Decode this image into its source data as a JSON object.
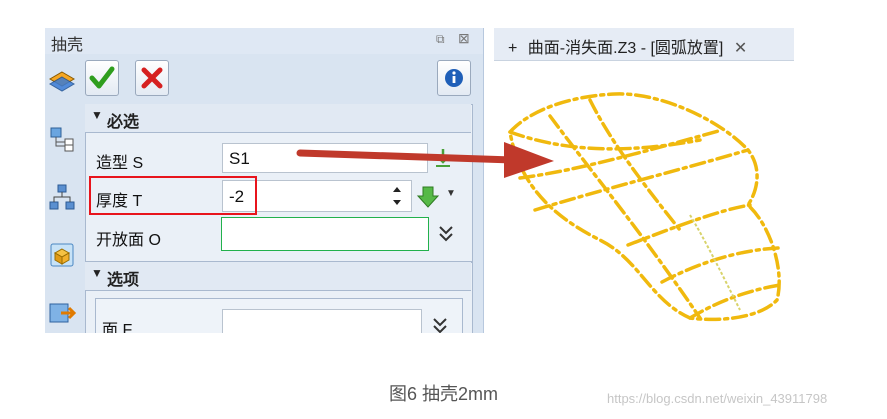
{
  "panel": {
    "title": "抽壳",
    "restore_glyph": "⧉",
    "close_glyph": "⊠",
    "toolbar": {
      "ok_icon": "check-icon",
      "cancel_icon": "x-icon",
      "info_icon": "info-icon"
    },
    "required_section": {
      "header": "必选",
      "fields": {
        "shape": {
          "label": "造型 S",
          "value": "S1"
        },
        "thickness": {
          "label": "厚度 T",
          "value": "-2"
        },
        "open_face": {
          "label": "开放面 O",
          "value": ""
        }
      }
    },
    "options_section": {
      "header": "选项",
      "fields": {
        "face": {
          "label": "面 F",
          "value": ""
        }
      }
    }
  },
  "canvas": {
    "tab": {
      "plus": "+",
      "title": "曲面-消失面.Z3 - [圆弧放置]",
      "close": "✕"
    }
  },
  "colors": {
    "highlight_box": "#e8141c",
    "arrow": "#c0392b",
    "surface": "#f0b90e",
    "open_face_border": "#22b14c"
  },
  "caption": "图6 抽壳2mm",
  "watermark": "https://blog.csdn.net/weixin_43911798"
}
